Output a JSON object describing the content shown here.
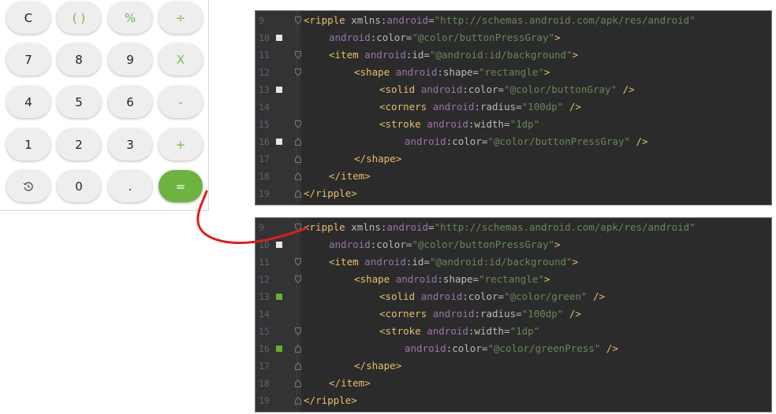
{
  "calculator": {
    "rows": [
      [
        {
          "label": "C",
          "kind": "normal"
        },
        {
          "label": "( )",
          "kind": "op"
        },
        {
          "label": "%",
          "kind": "op"
        },
        {
          "label": "÷",
          "kind": "op"
        }
      ],
      [
        {
          "label": "7",
          "kind": "normal"
        },
        {
          "label": "8",
          "kind": "normal"
        },
        {
          "label": "9",
          "kind": "normal"
        },
        {
          "label": "X",
          "kind": "op"
        }
      ],
      [
        {
          "label": "4",
          "kind": "normal"
        },
        {
          "label": "5",
          "kind": "normal"
        },
        {
          "label": "6",
          "kind": "normal"
        },
        {
          "label": "-",
          "kind": "op"
        }
      ],
      [
        {
          "label": "1",
          "kind": "normal"
        },
        {
          "label": "2",
          "kind": "normal"
        },
        {
          "label": "3",
          "kind": "normal"
        },
        {
          "label": "+",
          "kind": "op"
        }
      ],
      [
        {
          "label": "",
          "kind": "history",
          "icon": "history-icon"
        },
        {
          "label": "0",
          "kind": "normal"
        },
        {
          "label": ".",
          "kind": "normal"
        },
        {
          "label": "=",
          "kind": "equals"
        }
      ]
    ],
    "colors": {
      "button_bg": "#eeeeee",
      "operator_text": "#7ab648",
      "equals_bg": "#6cb33f"
    }
  },
  "colors": {
    "editor_bg": "#2b2b2b",
    "gutter_bg": "#313335",
    "arrow": "#e21b1b",
    "swatch_gray": "#e6e6e6",
    "swatch_green": "#66b032"
  },
  "code_panels": [
    {
      "lines": [
        {
          "num": "9",
          "indent": 0,
          "swatch": null,
          "fold": "open",
          "tokens": [
            [
              "p",
              "<"
            ],
            [
              "tag",
              "ripple"
            ],
            [
              "t",
              " xmlns:"
            ],
            [
              "ns",
              "android"
            ],
            [
              "t",
              "="
            ],
            [
              "str",
              "\"http://schemas.android.com/apk/res/android\""
            ]
          ]
        },
        {
          "num": "10",
          "indent": 1,
          "swatch": "gray",
          "fold": null,
          "tokens": [
            [
              "ns",
              "android"
            ],
            [
              "t",
              ":color="
            ],
            [
              "str",
              "\"@color/buttonPressGray\""
            ],
            [
              "p",
              ">"
            ]
          ]
        },
        {
          "num": "11",
          "indent": 1,
          "swatch": null,
          "fold": "open",
          "tokens": [
            [
              "p",
              "<"
            ],
            [
              "tag",
              "item"
            ],
            [
              "t",
              " "
            ],
            [
              "ns",
              "android"
            ],
            [
              "t",
              ":id="
            ],
            [
              "str",
              "\"@android:id/background\""
            ],
            [
              "p",
              ">"
            ]
          ]
        },
        {
          "num": "12",
          "indent": 2,
          "swatch": null,
          "fold": "open",
          "tokens": [
            [
              "p",
              "<"
            ],
            [
              "tag",
              "shape"
            ],
            [
              "t",
              " "
            ],
            [
              "ns",
              "android"
            ],
            [
              "t",
              ":shape="
            ],
            [
              "str",
              "\"rectangle\""
            ],
            [
              "p",
              ">"
            ]
          ]
        },
        {
          "num": "13",
          "indent": 3,
          "swatch": "gray",
          "fold": null,
          "tokens": [
            [
              "p",
              "<"
            ],
            [
              "tag",
              "solid"
            ],
            [
              "t",
              " "
            ],
            [
              "ns",
              "android"
            ],
            [
              "t",
              ":color="
            ],
            [
              "str",
              "\"@color/buttonGray\""
            ],
            [
              "t",
              " "
            ],
            [
              "p",
              "/>"
            ]
          ]
        },
        {
          "num": "14",
          "indent": 3,
          "swatch": null,
          "fold": null,
          "tokens": [
            [
              "p",
              "<"
            ],
            [
              "tag",
              "corners"
            ],
            [
              "t",
              " "
            ],
            [
              "ns",
              "android"
            ],
            [
              "t",
              ":radius="
            ],
            [
              "str",
              "\"100dp\""
            ],
            [
              "t",
              " "
            ],
            [
              "p",
              "/>"
            ]
          ]
        },
        {
          "num": "15",
          "indent": 3,
          "swatch": null,
          "fold": "open",
          "tokens": [
            [
              "p",
              "<"
            ],
            [
              "tag",
              "stroke"
            ],
            [
              "t",
              " "
            ],
            [
              "ns",
              "android"
            ],
            [
              "t",
              ":width="
            ],
            [
              "str",
              "\"1dp\""
            ]
          ]
        },
        {
          "num": "16",
          "indent": 4,
          "swatch": "gray",
          "fold": "close",
          "tokens": [
            [
              "ns",
              "android"
            ],
            [
              "t",
              ":color="
            ],
            [
              "str",
              "\"@color/buttonPressGray\""
            ],
            [
              "t",
              " "
            ],
            [
              "p",
              "/>"
            ]
          ]
        },
        {
          "num": "17",
          "indent": 2,
          "swatch": null,
          "fold": "close",
          "tokens": [
            [
              "p",
              "</"
            ],
            [
              "tag",
              "shape"
            ],
            [
              "p",
              ">"
            ]
          ]
        },
        {
          "num": "18",
          "indent": 1,
          "swatch": null,
          "fold": "close",
          "tokens": [
            [
              "p",
              "</"
            ],
            [
              "tag",
              "item"
            ],
            [
              "p",
              ">"
            ]
          ]
        },
        {
          "num": "19",
          "indent": 0,
          "swatch": null,
          "fold": "close",
          "tokens": [
            [
              "p",
              "</"
            ],
            [
              "tag",
              "ripple"
            ],
            [
              "p",
              ">"
            ]
          ]
        }
      ]
    },
    {
      "lines": [
        {
          "num": "9",
          "indent": 0,
          "swatch": null,
          "fold": "open",
          "tokens": [
            [
              "p",
              "<"
            ],
            [
              "tag",
              "ripple"
            ],
            [
              "t",
              " xmlns:"
            ],
            [
              "ns",
              "android"
            ],
            [
              "t",
              "="
            ],
            [
              "str",
              "\"http://schemas.android.com/apk/res/android\""
            ]
          ]
        },
        {
          "num": "10",
          "indent": 1,
          "swatch": "gray",
          "fold": null,
          "tokens": [
            [
              "ns",
              "android"
            ],
            [
              "t",
              ":color="
            ],
            [
              "str",
              "\"@color/buttonPressGray\""
            ],
            [
              "p",
              ">"
            ]
          ]
        },
        {
          "num": "11",
          "indent": 1,
          "swatch": null,
          "fold": "open",
          "tokens": [
            [
              "p",
              "<"
            ],
            [
              "tag",
              "item"
            ],
            [
              "t",
              " "
            ],
            [
              "ns",
              "android"
            ],
            [
              "t",
              ":id="
            ],
            [
              "str",
              "\"@android:id/background\""
            ],
            [
              "p",
              ">"
            ]
          ]
        },
        {
          "num": "12",
          "indent": 2,
          "swatch": null,
          "fold": "open",
          "tokens": [
            [
              "p",
              "<"
            ],
            [
              "tag",
              "shape"
            ],
            [
              "t",
              " "
            ],
            [
              "ns",
              "android"
            ],
            [
              "t",
              ":shape="
            ],
            [
              "str",
              "\"rectangle\""
            ],
            [
              "p",
              ">"
            ]
          ]
        },
        {
          "num": "13",
          "indent": 3,
          "swatch": "green",
          "fold": null,
          "tokens": [
            [
              "p",
              "<"
            ],
            [
              "tag",
              "solid"
            ],
            [
              "t",
              " "
            ],
            [
              "ns",
              "android"
            ],
            [
              "t",
              ":color="
            ],
            [
              "str",
              "\"@color/green\""
            ],
            [
              "t",
              " "
            ],
            [
              "p",
              "/>"
            ]
          ]
        },
        {
          "num": "14",
          "indent": 3,
          "swatch": null,
          "fold": null,
          "tokens": [
            [
              "p",
              "<"
            ],
            [
              "tag",
              "corners"
            ],
            [
              "t",
              " "
            ],
            [
              "ns",
              "android"
            ],
            [
              "t",
              ":radius="
            ],
            [
              "str",
              "\"100dp\""
            ],
            [
              "t",
              " "
            ],
            [
              "p",
              "/>"
            ]
          ]
        },
        {
          "num": "15",
          "indent": 3,
          "swatch": null,
          "fold": "open",
          "tokens": [
            [
              "p",
              "<"
            ],
            [
              "tag",
              "stroke"
            ],
            [
              "t",
              " "
            ],
            [
              "ns",
              "android"
            ],
            [
              "t",
              ":width="
            ],
            [
              "str",
              "\"1dp\""
            ]
          ]
        },
        {
          "num": "16",
          "indent": 4,
          "swatch": "green",
          "fold": "close",
          "tokens": [
            [
              "ns",
              "android"
            ],
            [
              "t",
              ":color="
            ],
            [
              "str",
              "\"@color/greenPress\""
            ],
            [
              "t",
              " "
            ],
            [
              "p",
              "/>"
            ]
          ]
        },
        {
          "num": "17",
          "indent": 2,
          "swatch": null,
          "fold": "close",
          "tokens": [
            [
              "p",
              "</"
            ],
            [
              "tag",
              "shape"
            ],
            [
              "p",
              ">"
            ]
          ]
        },
        {
          "num": "18",
          "indent": 1,
          "swatch": null,
          "fold": "close",
          "tokens": [
            [
              "p",
              "</"
            ],
            [
              "tag",
              "item"
            ],
            [
              "p",
              ">"
            ]
          ]
        },
        {
          "num": "19",
          "indent": 0,
          "swatch": null,
          "fold": "close",
          "tokens": [
            [
              "p",
              "</"
            ],
            [
              "tag",
              "ripple"
            ],
            [
              "p",
              ">"
            ]
          ]
        }
      ]
    }
  ]
}
